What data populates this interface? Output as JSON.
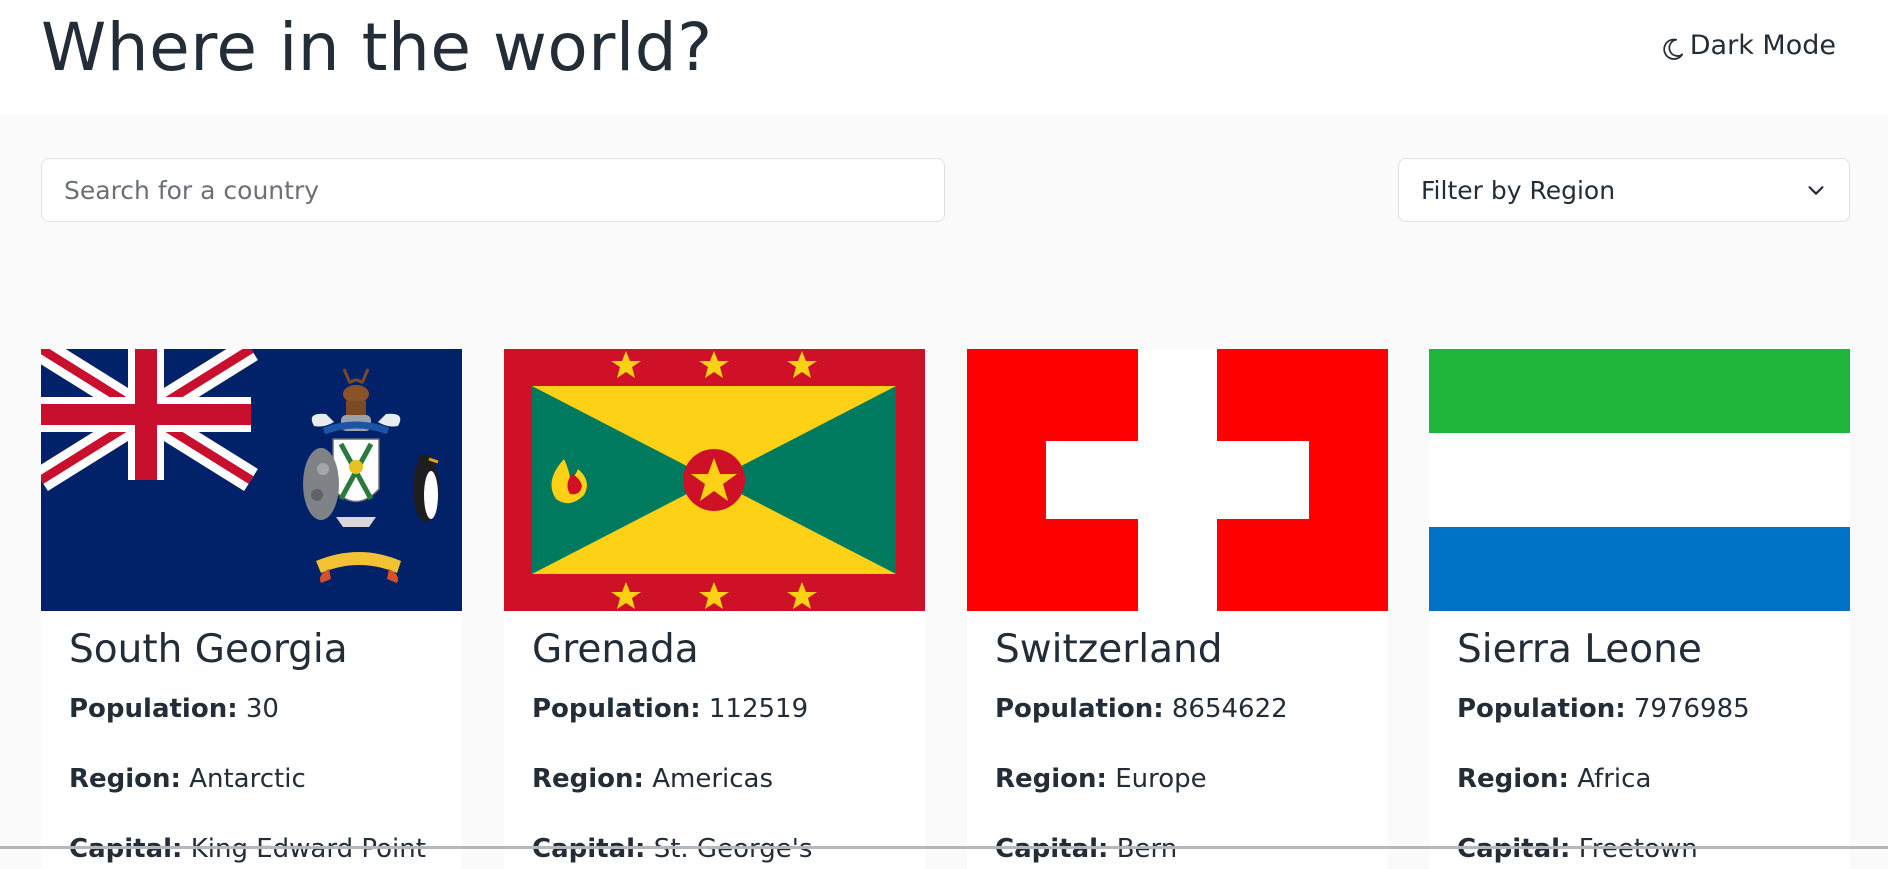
{
  "header": {
    "title": "Where in the world?",
    "dark_mode_label": "Dark Mode",
    "dark_mode_icon": "moon-icon"
  },
  "search": {
    "placeholder": "Search for a country",
    "value": ""
  },
  "filter": {
    "label": "Filter by Region",
    "icon": "chevron-down-icon"
  },
  "labels": {
    "population": "Population:",
    "region": "Region:",
    "capital": "Capital:"
  },
  "countries": [
    {
      "name": "South Georgia",
      "population": "30",
      "region": "Antarctic",
      "capital": "King Edward Point"
    },
    {
      "name": "Grenada",
      "population": "112519",
      "region": "Americas",
      "capital": "St. George's"
    },
    {
      "name": "Switzerland",
      "population": "8654622",
      "region": "Europe",
      "capital": "Bern"
    },
    {
      "name": "Sierra Leone",
      "population": "7976985",
      "region": "Africa",
      "capital": "Freetown"
    }
  ],
  "colors": {
    "text": "#222d38",
    "background": "#fafafa",
    "surface": "#ffffff",
    "border": "#dfe1e3"
  }
}
